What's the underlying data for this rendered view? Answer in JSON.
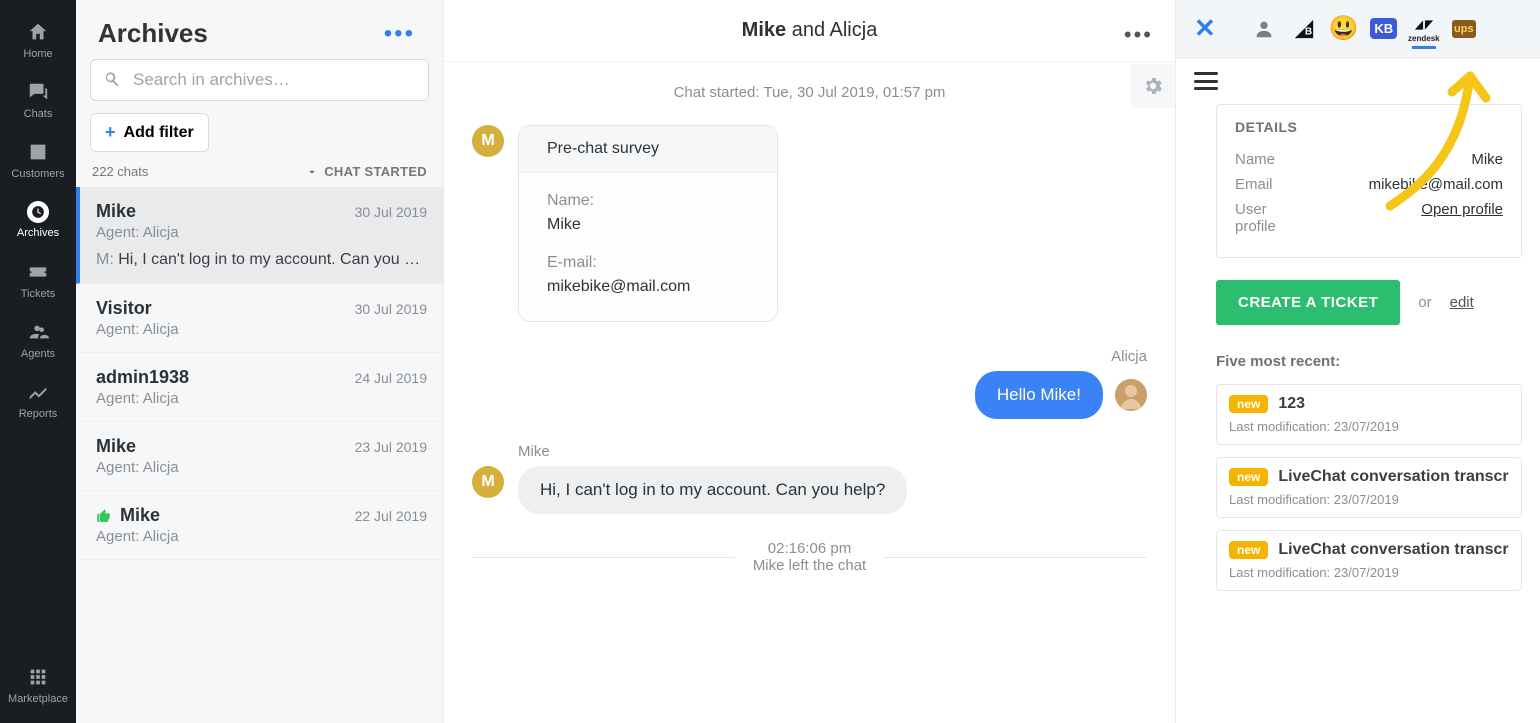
{
  "nav": {
    "items": [
      {
        "label": "Home"
      },
      {
        "label": "Chats"
      },
      {
        "label": "Customers"
      },
      {
        "label": "Archives"
      },
      {
        "label": "Tickets"
      },
      {
        "label": "Agents"
      },
      {
        "label": "Reports"
      }
    ],
    "marketplace": "Marketplace"
  },
  "archives": {
    "title": "Archives",
    "search_placeholder": "Search in archives…",
    "add_filter": "Add filter",
    "count_label": "222 chats",
    "sort_label": "CHAT STARTED",
    "items": [
      {
        "name": "Mike",
        "date": "30 Jul 2019",
        "agent": "Agent: Alicja",
        "preview_prefix": "M:",
        "preview": "Hi, I can't log in to my account. Can you …"
      },
      {
        "name": "Visitor",
        "date": "30 Jul 2019",
        "agent": "Agent: Alicja"
      },
      {
        "name": "admin1938",
        "date": "24 Jul 2019",
        "agent": "Agent: Alicja"
      },
      {
        "name": "Mike",
        "date": "23 Jul 2019",
        "agent": "Agent: Alicja"
      },
      {
        "name": "Mike",
        "date": "22 Jul 2019",
        "agent": "Agent: Alicja",
        "thumbs": true
      }
    ]
  },
  "convo": {
    "title_bold": "Mike",
    "title_rest": " and Alicja",
    "started": "Chat started: Tue, 30 Jul 2019, 01:57 pm",
    "survey_title": "Pre-chat survey",
    "survey": {
      "name_label": "Name:",
      "name_value": "Mike",
      "email_label": "E-mail:",
      "email_value": "mikebike@mail.com"
    },
    "agent_name": "Alicja",
    "agent_msg": "Hello Mike!",
    "customer_name": "Mike",
    "customer_msg": "Hi, I can't log in to my account. Can you help?",
    "left_time": "02:16:06 pm",
    "left_text": "Mike left the chat"
  },
  "details": {
    "heading": "DETAILS",
    "name_label": "Name",
    "name_value": "Mike",
    "email_label": "Email",
    "email_value": "mikebike@mail.com",
    "profile_label": "User profile",
    "profile_link": "Open profile"
  },
  "ticket": {
    "create": "CREATE A TICKET",
    "or": "or",
    "edit": "edit"
  },
  "recent": {
    "heading": "Five most recent:",
    "items": [
      {
        "tag": "new",
        "title": "123",
        "mod": "Last modification: 23/07/2019"
      },
      {
        "tag": "new",
        "title": "LiveChat conversation transcript",
        "mod": "Last modification: 23/07/2019"
      },
      {
        "tag": "new",
        "title": "LiveChat conversation transcript",
        "mod": "Last modification: 23/07/2019"
      }
    ]
  }
}
